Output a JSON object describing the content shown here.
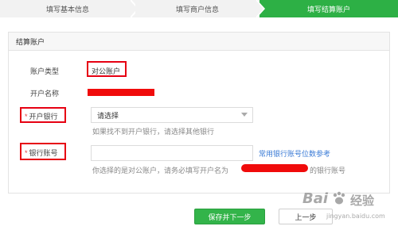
{
  "steps": [
    {
      "label": "填写基本信息",
      "state": "done"
    },
    {
      "label": "填写商户信息",
      "state": "done"
    },
    {
      "label": "填写结算账户",
      "state": "active"
    }
  ],
  "panel": {
    "title": "结算账户",
    "account_type": {
      "label": "账户类型",
      "value": "对公账户"
    },
    "account_name": {
      "label": "开户名称"
    },
    "bank": {
      "required_mark": "*",
      "label": "开户银行",
      "select_value": "请选择",
      "hint": "如果找不到开户银行，请选择其他银行"
    },
    "account_number": {
      "required_mark": "*",
      "label": "银行账号",
      "input_value": "",
      "link": "常用银行账号位数参考",
      "hint_prefix": "你选择的是对公账户，请务必填写开户名为",
      "hint_suffix": "的银行账号"
    }
  },
  "buttons": {
    "save_next": "保存并下一步",
    "previous": "上一步"
  },
  "watermark": {
    "text": "Bai",
    "text2": "经验",
    "sub": "jingyan.baidu.com"
  },
  "colors": {
    "accent_green": "#2db045",
    "annotation_red": "#e60012",
    "link_blue": "#3b7bd6"
  }
}
